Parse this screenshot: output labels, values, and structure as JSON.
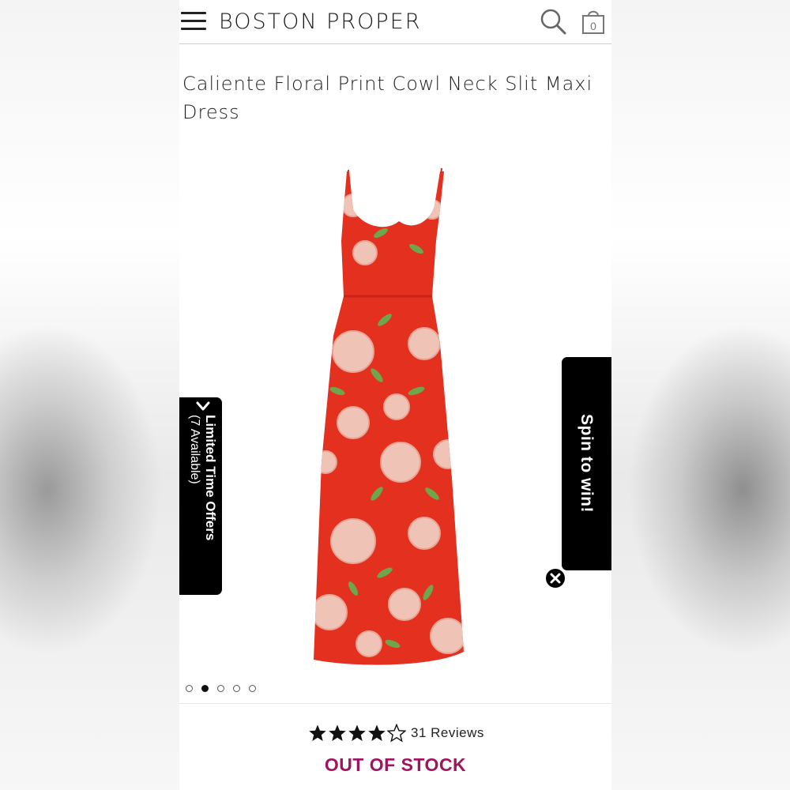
{
  "header": {
    "brand": "BOSTON PROPER",
    "menu_icon": "hamburger-menu-icon",
    "search_icon": "search-icon",
    "bag_icon": "shopping-bag-icon",
    "bag_count": "0"
  },
  "product": {
    "title": "Caliente Floral Print Cowl Neck Slit Maxi Dress",
    "image": "red-floral-maxi-dress",
    "carousel": {
      "total": 5,
      "active_index": 1
    },
    "rating": {
      "value": 4,
      "max": 5
    },
    "reviews_label": "31 Reviews",
    "stock_status": "OUT OF STOCK"
  },
  "offers_tab": {
    "label": "Limited Time Offers",
    "sub": "(7 Available)"
  },
  "spin_tab": {
    "label": "Spin to win!"
  },
  "colors": {
    "stock": "#a0135e",
    "dress": "#e3301f",
    "tab": "#000000"
  }
}
